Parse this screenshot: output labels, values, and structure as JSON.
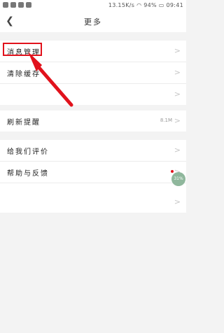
{
  "status_bar": {
    "network_speed": "13.15K/s",
    "battery": "94%",
    "time": "09:41"
  },
  "header": {
    "title": "更多"
  },
  "groups": {
    "group1": [
      {
        "label": "消息管理"
      },
      {
        "label": "清除缓存"
      },
      {
        "label": ""
      }
    ],
    "group2": [
      {
        "label": "刷新提醒",
        "value": "8.1M"
      }
    ],
    "group3": [
      {
        "label": "给我们评价"
      },
      {
        "label": "帮助与反馈"
      },
      {
        "label": ""
      }
    ]
  },
  "float_ball": {
    "text": "31%"
  },
  "colors": {
    "highlight": "#e1121c",
    "page_bg": "#f3f3f3"
  }
}
